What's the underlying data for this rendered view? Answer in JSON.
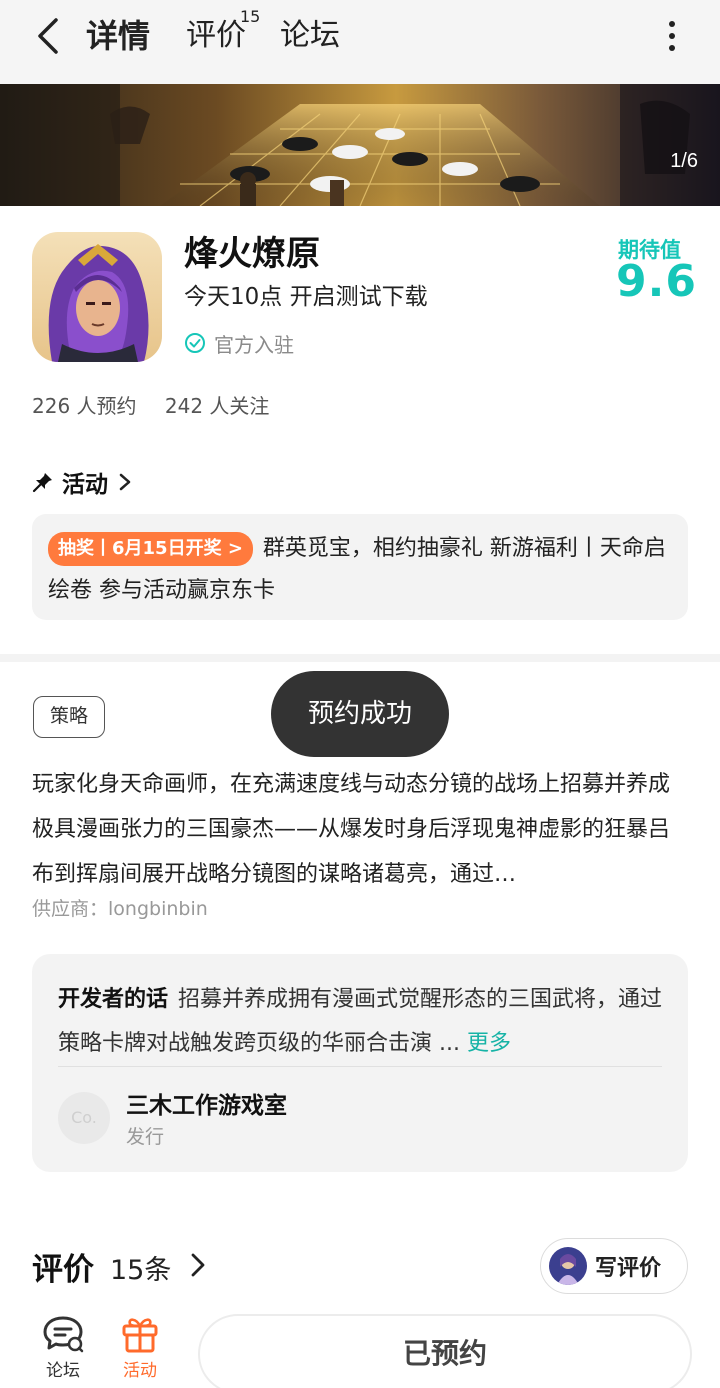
{
  "nav": {
    "tabs": [
      {
        "label": "详情"
      },
      {
        "label": "评价",
        "count": "15"
      },
      {
        "label": "论坛"
      }
    ]
  },
  "banner": {
    "indicator": "1/6"
  },
  "game": {
    "name": "烽火燎原",
    "subtitle": "今天10点 开启测试下载",
    "official_label": "官方入驻",
    "expect_label": "期待值",
    "expect_value": "9.6",
    "reservations": "226 人预约",
    "follows": "242 人关注"
  },
  "activity": {
    "title": "活动",
    "badge": "抽奖丨6月15日开奖 >",
    "text": "群英觅宝，相约抽豪礼 新游福利丨天命启绘卷 参与活动赢京东卡"
  },
  "strategy_tag": "策略",
  "toast": "预约成功",
  "description": "玩家化身天命画师，在充满速度线与动态分镜的战场上招募并养成极具漫画张力的三国豪杰——从爆发时身后浮现鬼神虚影的狂暴吕布到挥扇间展开战略分镜图的谋略诸葛亮，通过…",
  "supplier": "供应商：longbinbin",
  "developer": {
    "lead": "开发者的话",
    "words": "招募并养成拥有漫画式觉醒形态的三国武将，通过策略卡牌对战触发跨页级的华丽合击演 ...",
    "more": "更多",
    "avatar_text": "Co.",
    "name": "三木工作游戏室",
    "role": "发行"
  },
  "reviews": {
    "title": "评价",
    "count": "15条",
    "write": "写评价"
  },
  "bottom": {
    "forum": "论坛",
    "activity": "活动",
    "reserved": "已预约"
  },
  "colors": {
    "accent": "#16c6b8",
    "orange": "#ff7a3d",
    "toast_bg": "#333333"
  }
}
